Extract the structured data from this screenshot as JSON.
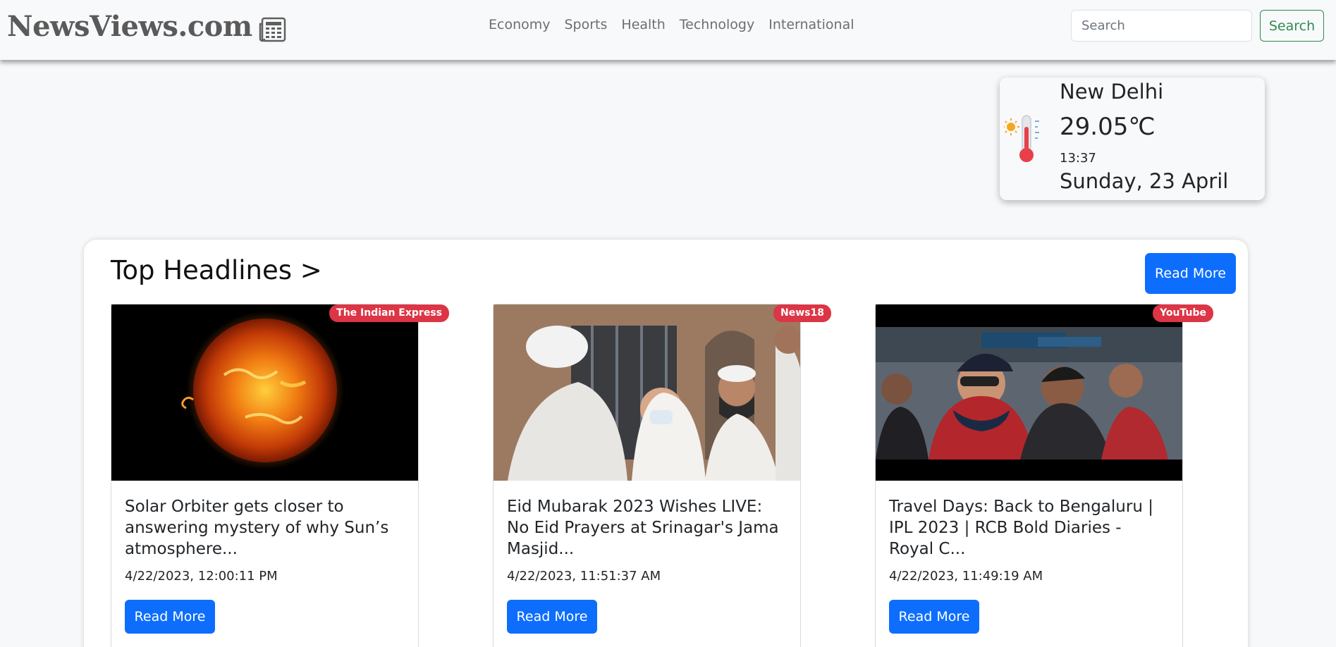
{
  "brand": {
    "name": "NewsViews.com",
    "icon": "newspaper-icon"
  },
  "nav": {
    "items": [
      "Economy",
      "Sports",
      "Health",
      "Technology",
      "International"
    ]
  },
  "search": {
    "placeholder": "Search",
    "button_label": "Search"
  },
  "weather": {
    "city": "New Delhi",
    "temperature": "29.05℃",
    "time": "13:37",
    "date": "Sunday, 23 April",
    "icon": "thermometer-sun-icon"
  },
  "headlines": {
    "title": "Top Headlines >",
    "read_more_label": "Read More",
    "cards": [
      {
        "source": "The Indian Express",
        "title": "Solar Orbiter gets closer to answering mystery of why Sun’s atmosphere...",
        "date": "4/22/2023, 12:00:11 PM",
        "button": "Read More",
        "image": "sun-photo"
      },
      {
        "source": "News18",
        "title": "Eid Mubarak 2023 Wishes LIVE: No Eid Prayers at Srinagar's Jama Masjid...",
        "date": "4/22/2023, 11:51:37 AM",
        "button": "Read More",
        "image": "eid-gathering-photo"
      },
      {
        "source": "YouTube",
        "title": "Travel Days: Back to Bengaluru | IPL 2023 | RCB Bold Diaries - Royal C...",
        "date": "4/22/2023, 11:49:19 AM",
        "button": "Read More",
        "image": "rcb-players-video-thumbnail"
      }
    ]
  },
  "colors": {
    "primary": "#0d6efd",
    "badge": "#dc3545",
    "search_outline": "#2f8a53",
    "navbar_bg": "#f8f9fa"
  }
}
